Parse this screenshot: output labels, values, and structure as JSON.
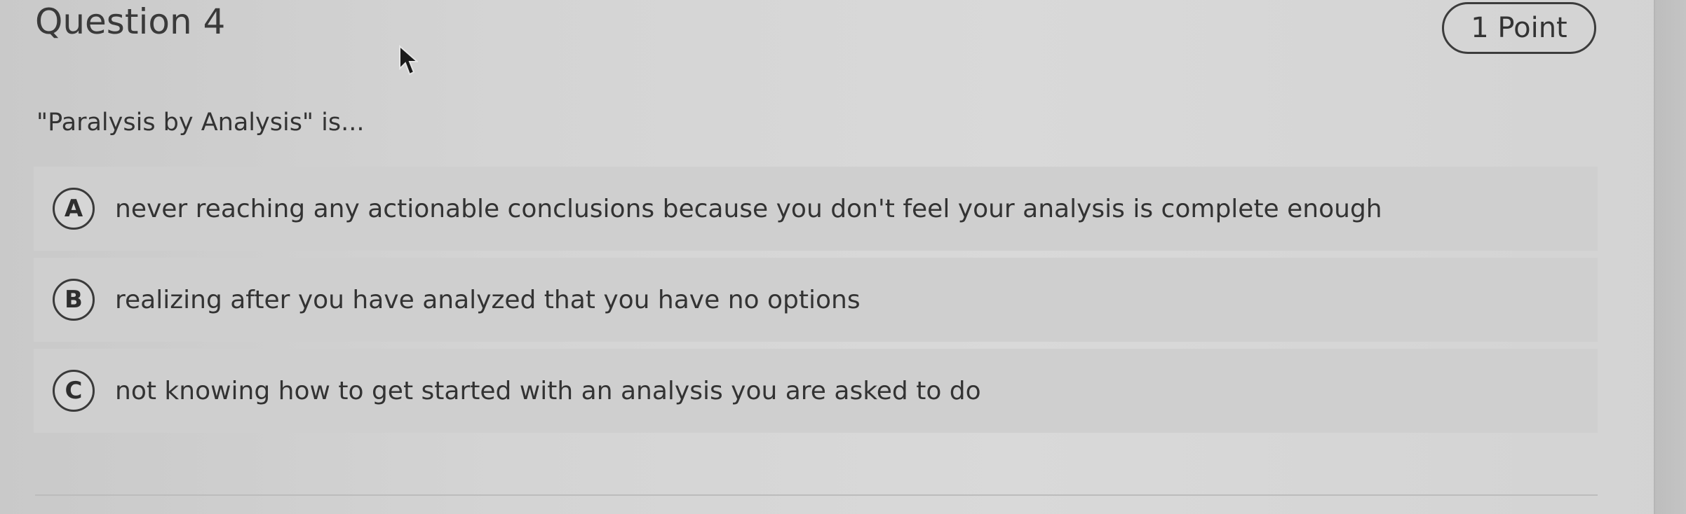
{
  "question": {
    "title": "Question 4",
    "points": "1 Point",
    "prompt": "\"Paralysis by Analysis\" is..."
  },
  "options": [
    {
      "letter": "A",
      "text": "never reaching any actionable conclusions because you don't feel your analysis is complete enough"
    },
    {
      "letter": "B",
      "text": "realizing after you have analyzed that you have no options"
    },
    {
      "letter": "C",
      "text": "not knowing how to get started with an analysis you are asked to do"
    }
  ],
  "icons": {
    "cursor": "mouse-pointer-icon"
  }
}
